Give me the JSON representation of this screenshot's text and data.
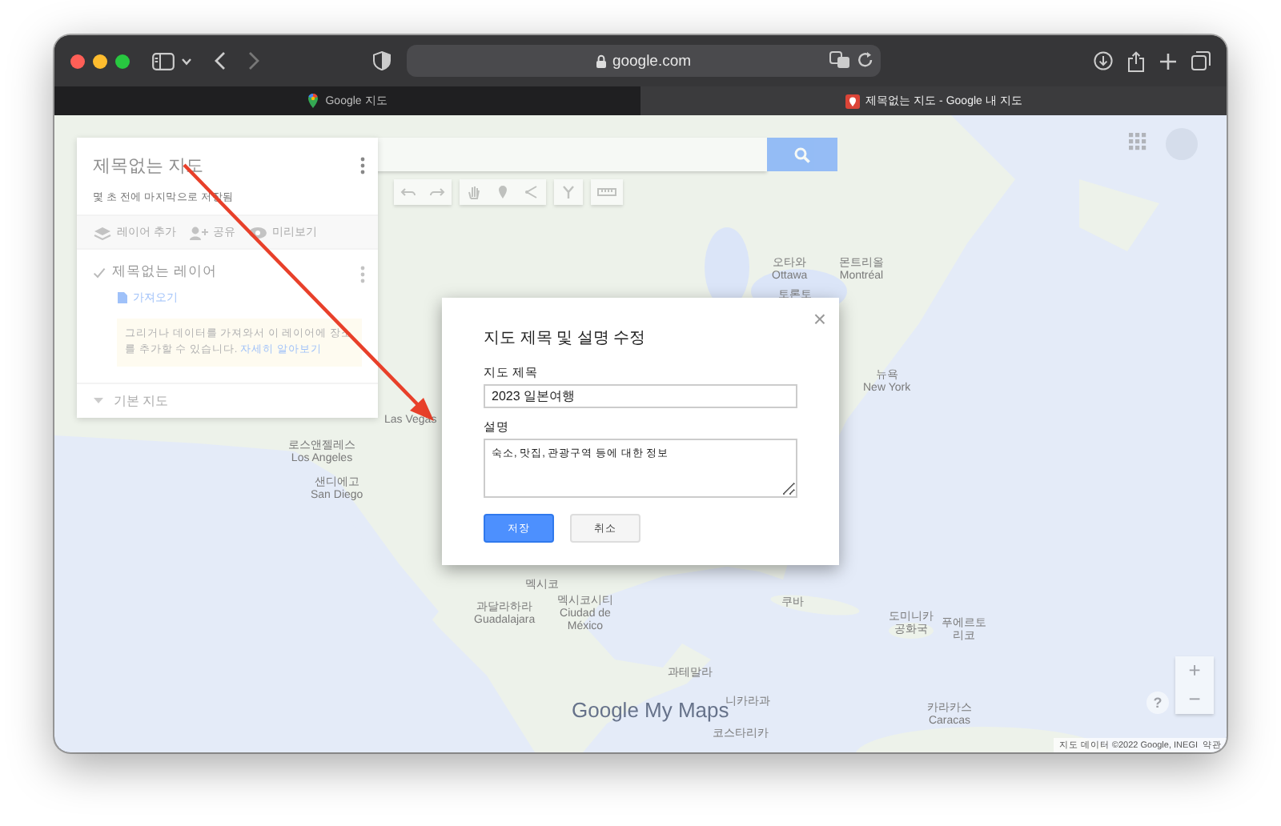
{
  "browser": {
    "url": "google.com",
    "tabs": [
      {
        "title": "Google 지도",
        "selected": false
      },
      {
        "title": "제목없는 지도 - Google 내 지도",
        "selected": true
      }
    ]
  },
  "map": {
    "labels": [
      {
        "text": "오타와\nOttawa"
      },
      {
        "text": "몬트리올\nMontréal"
      },
      {
        "text": "토론토"
      },
      {
        "text": "뉴욕\nNew York"
      },
      {
        "text": "Las Vegas"
      },
      {
        "text": "로스앤젤레스\nLos Angeles"
      },
      {
        "text": "샌디에고\nSan Diego"
      },
      {
        "text": "멕시코"
      },
      {
        "text": "과달라하라\nGuadalajara"
      },
      {
        "text": "멕시코시티\nCiudad de\nMéxico"
      },
      {
        "text": "쿠바"
      },
      {
        "text": "도미니카\n공화국"
      },
      {
        "text": "푸에르토\n리코"
      },
      {
        "text": "과테말라"
      },
      {
        "text": "니카라과"
      },
      {
        "text": "코스타리카"
      },
      {
        "text": "카라카스\nCaracas"
      }
    ],
    "logo": "Google My Maps",
    "attribution": "지도 데이터 ©2022 Google, INEGI",
    "terms": "약관",
    "zoom_in": "+",
    "zoom_out": "−",
    "help": "?"
  },
  "sidebar": {
    "title": "제목없는 지도",
    "subtitle": "몇 초 전에 마지막으로 저장됨",
    "actions": [
      {
        "label": "레이어 추가",
        "kind": "layers"
      },
      {
        "label": "공유",
        "kind": "share"
      },
      {
        "label": "미리보기",
        "kind": "preview"
      }
    ],
    "layer": {
      "name": "제목없는 레이어",
      "checked": true,
      "import": "가져오기",
      "hint": "그리거나 데이터를 가져와서 이 레이어에 장소를 추가할 수 있습니다.",
      "hint_link": "자세히 알아보기"
    },
    "basemap": "기본 지도"
  },
  "dialog": {
    "title": "지도 제목 및 설명 수정",
    "close": "×",
    "fields": [
      {
        "label": "지도 제목",
        "value": "2023 일본여행",
        "kind": "text"
      },
      {
        "label": "설명",
        "value": "숙소, 맛집, 관광구역 등에 대한 정보",
        "kind": "textarea"
      }
    ],
    "buttons": [
      {
        "label": "저장",
        "kind": "primary"
      },
      {
        "label": "취소",
        "kind": "secondary"
      }
    ]
  }
}
